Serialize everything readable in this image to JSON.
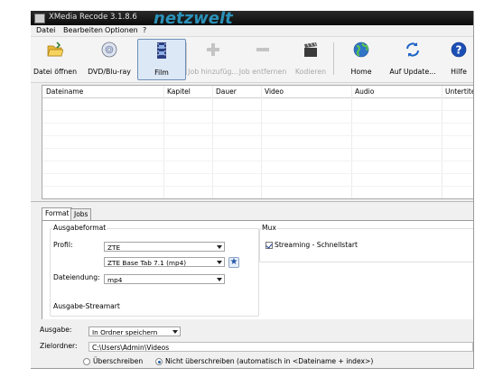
{
  "window": {
    "title": "XMedia Recode 3.1.8.6",
    "watermark": "netzwelt"
  },
  "menu": [
    "Datei",
    "Bearbeiten",
    "Optionen",
    "?"
  ],
  "toolbar": {
    "buttons": [
      {
        "label": "Datei öffnen",
        "icon": "folder-open-icon",
        "enabled": true
      },
      {
        "label": "DVD/Blu-ray",
        "icon": "disc-icon",
        "enabled": true
      },
      {
        "label": "Film",
        "icon": "film-icon",
        "enabled": true,
        "selected": true
      },
      {
        "label": "Job hinzufüg...",
        "icon": "plus-icon",
        "enabled": false
      },
      {
        "label": "Job entfernen",
        "icon": "minus-icon",
        "enabled": false
      },
      {
        "label": "Kodieren",
        "icon": "clapperboard-icon",
        "enabled": false
      },
      {
        "label": "Home",
        "icon": "globe-icon",
        "enabled": true
      },
      {
        "label": "Auf Update...",
        "icon": "refresh-icon",
        "enabled": true
      },
      {
        "label": "Hilfe",
        "icon": "help-icon",
        "enabled": true
      }
    ]
  },
  "table": {
    "columns": [
      "Dateiname",
      "Kapitel",
      "Dauer",
      "Video",
      "Audio",
      "Untertitel"
    ],
    "rows": []
  },
  "tabs": {
    "items": [
      "Format",
      "Jobs"
    ],
    "active": "Format"
  },
  "format": {
    "ausgabeformat_title": "Ausgabeformat",
    "profil_label": "Profil:",
    "profil_value": "ZTE",
    "profil_sub_value": "ZTE Base Tab 7.1 (mp4)",
    "dateiendung_label": "Dateiendung:",
    "dateiendung_value": "mp4",
    "streamart_title": "Ausgabe-Streamart",
    "mux_title": "Mux",
    "streaming_label": "Streaming - Schnellstart",
    "streaming_checked": true
  },
  "output": {
    "ausgabe_label": "Ausgabe:",
    "ausgabe_value": "In Ordner speichern",
    "zielordner_label": "Zielordner:",
    "zielordner_value": "C:\\Users\\Admin\\Videos",
    "overwrite_label": "Überschreiben",
    "no_overwrite_label": "Nicht überschreiben (automatisch in <Dateiname + index>)",
    "selected_option": "no_overwrite"
  },
  "colors": {
    "titlebar": "#151515",
    "selected_button": "#dce8f6",
    "accent": "#1e5ea8"
  }
}
